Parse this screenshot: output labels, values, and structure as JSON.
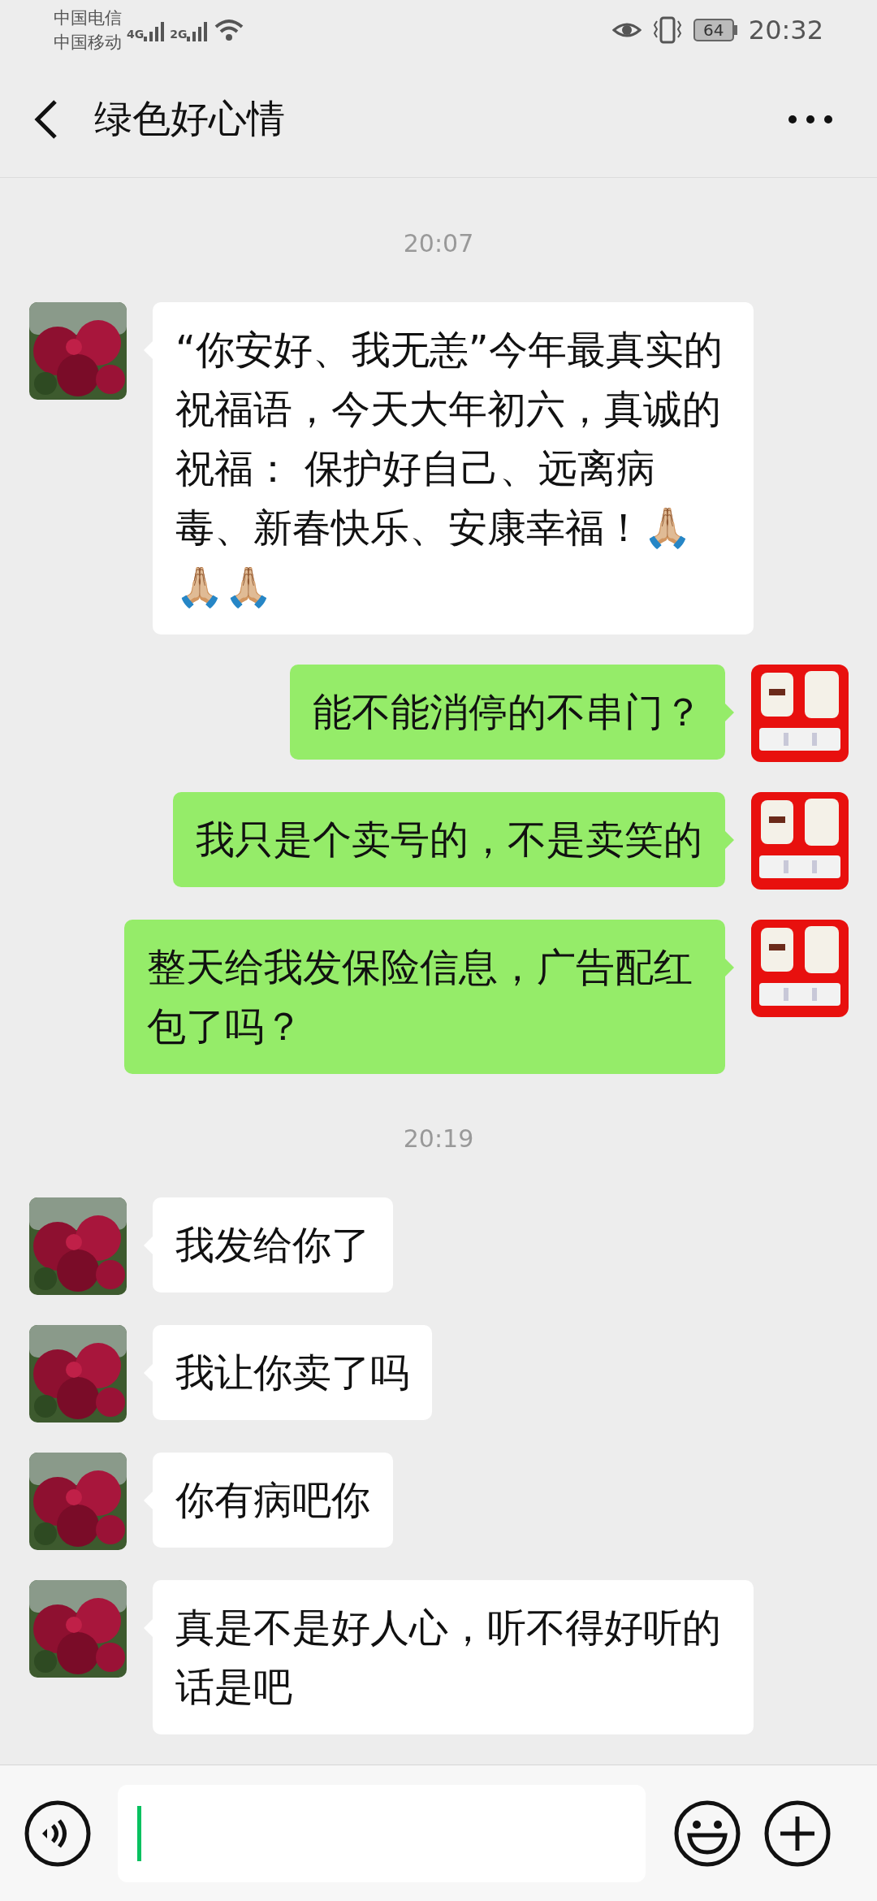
{
  "status_bar": {
    "carriers": [
      "中国电信",
      "中国移动"
    ],
    "networks": [
      "4G",
      "2G"
    ],
    "battery": "64",
    "time": "20:32"
  },
  "header": {
    "title": "绿色好心情"
  },
  "messages": [
    {
      "kind": "time",
      "text": "20:07"
    },
    {
      "kind": "incoming",
      "text": "“你安好、我无恙”今年最真实的祝福语，今天大年初六，真诚的祝福： 保护好自己、远离病毒、新春快乐、安康幸福！🙏🏼🙏🏼🙏🏼"
    },
    {
      "kind": "outgoing",
      "text": "能不能消停的不串门？"
    },
    {
      "kind": "outgoing",
      "text": "我只是个卖号的，不是卖笑的"
    },
    {
      "kind": "outgoing",
      "text": "整天给我发保险信息，广告配红包了吗？"
    },
    {
      "kind": "time",
      "text": "20:19"
    },
    {
      "kind": "incoming",
      "text": "我发给你了"
    },
    {
      "kind": "incoming",
      "text": "我让你卖了吗"
    },
    {
      "kind": "incoming",
      "text": "你有病吧你"
    },
    {
      "kind": "incoming",
      "text": "真是不是好人心，听不得好听的话是吧"
    }
  ]
}
